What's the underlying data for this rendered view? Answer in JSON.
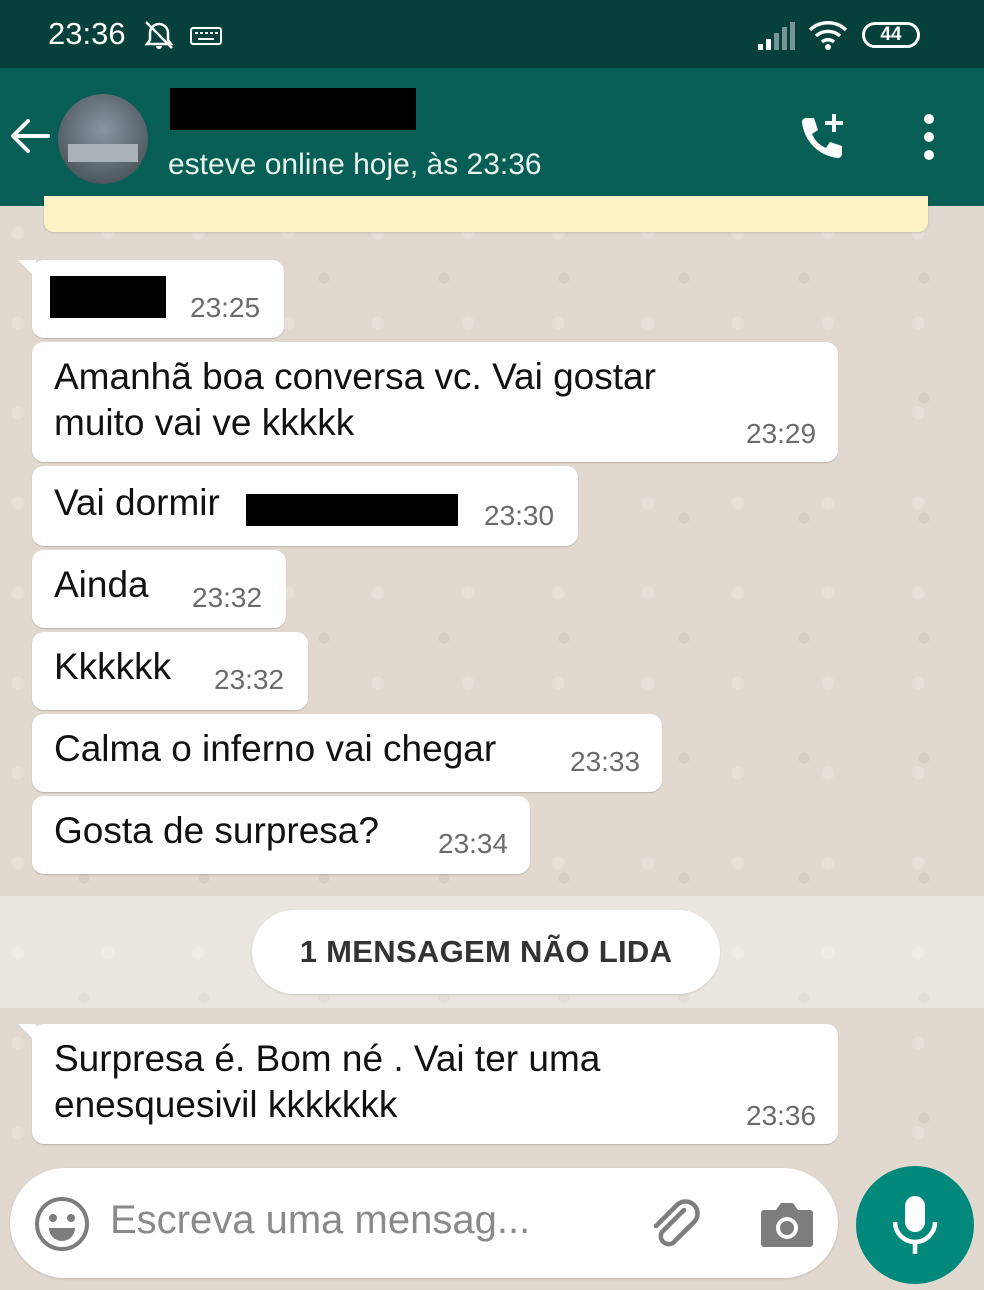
{
  "status_bar": {
    "time": "23:36",
    "battery": "44",
    "icons": [
      "alarm-off-icon",
      "keyboard-icon",
      "signal-icon",
      "wifi-icon",
      "battery-icon"
    ]
  },
  "header": {
    "back_icon": "arrow-back-icon",
    "contact_name": "",
    "status": "esteve online hoje, às 23:36",
    "call_icon": "add-call-icon",
    "menu_icon": "more-vert-icon",
    "color": "#075e54"
  },
  "messages": [
    {
      "text": "",
      "time": "23:25",
      "redacted": true
    },
    {
      "text": "Amanhã boa conversa vc. Vai gostar\nmuito vai ve kkkkk",
      "time": "23:29"
    },
    {
      "text": "Vai dormir",
      "time": "23:30",
      "redacted_suffix": true
    },
    {
      "text": "Ainda",
      "time": "23:32"
    },
    {
      "text": "Kkkkkk",
      "time": "23:32"
    },
    {
      "text": "Calma o inferno vai chegar",
      "time": "23:33"
    },
    {
      "text": "Gosta de surpresa?",
      "time": "23:34"
    }
  ],
  "unread_divider": {
    "label": "1 MENSAGEM NÃO LIDA"
  },
  "unread_messages": [
    {
      "text": "Surpresa é. Bom né . Vai ter uma\nenesquesivil kkkkkkk",
      "time": "23:36"
    }
  ],
  "composer": {
    "placeholder": "Escreva uma mensag...",
    "icons": [
      "emoji-icon",
      "attach-icon",
      "camera-icon",
      "mic-icon"
    ],
    "accent": "#00897b"
  }
}
